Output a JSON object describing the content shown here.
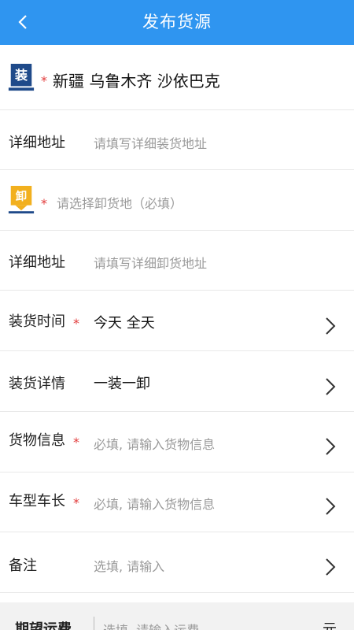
{
  "header": {
    "title": "发布货源",
    "back_icon": "chevron-left-icon"
  },
  "loading": {
    "badge_text": "装",
    "required_mark": "*",
    "location": "新疆 乌鲁木齐 沙依巴克"
  },
  "loading_address": {
    "label": "详细地址",
    "placeholder": "请填写详细装货地址"
  },
  "unloading": {
    "badge_text": "卸",
    "required_mark": "*",
    "placeholder": "请选择卸货地（必填）"
  },
  "unloading_address": {
    "label": "详细地址",
    "placeholder": "请填写详细卸货地址"
  },
  "loading_time": {
    "label": "装货时间",
    "required_mark": "*",
    "value": "今天 全天"
  },
  "loading_detail": {
    "label": "装货详情",
    "value": "一装一卸"
  },
  "cargo_info": {
    "label": "货物信息",
    "required_mark": "*",
    "placeholder": "必填, 请输入货物信息"
  },
  "vehicle": {
    "label": "车型车长",
    "required_mark": "*",
    "placeholder": "必填, 请输入货物信息"
  },
  "remark": {
    "label": "备注",
    "placeholder": "选填, 请输入"
  },
  "freight": {
    "label": "期望运费",
    "placeholder": "选填, 请输入运费",
    "unit": "元"
  },
  "colors": {
    "primary": "#2f95f0",
    "loading_badge": "#1f4a8a",
    "unloading_badge": "#f2b01e",
    "required": "#e23b3b"
  }
}
